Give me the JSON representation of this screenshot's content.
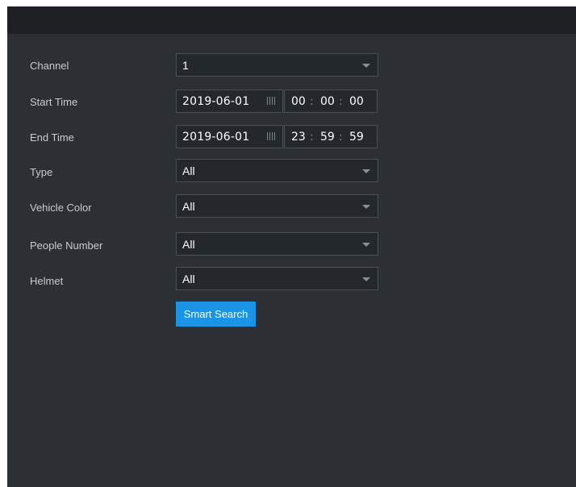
{
  "form": {
    "channel": {
      "label": "Channel",
      "value": "1"
    },
    "start_time": {
      "label": "Start Time",
      "date": "2019-06-01",
      "hh": "00",
      "mm": "00",
      "ss": "00"
    },
    "end_time": {
      "label": "End Time",
      "date": "2019-06-01",
      "hh": "23",
      "mm": "59",
      "ss": "59"
    },
    "type": {
      "label": "Type",
      "value": "All"
    },
    "vehicle_color": {
      "label": "Vehicle Color",
      "value": "All"
    },
    "people_number": {
      "label": "People Number",
      "value": "All"
    },
    "helmet": {
      "label": "Helmet",
      "value": "All"
    },
    "time_separator": ":"
  },
  "actions": {
    "smart_search_label": "Smart Search"
  },
  "colors": {
    "accent": "#1b94e8",
    "panel_bg": "#2c2f34",
    "titlebar_bg": "#1e2024"
  },
  "icons": {
    "dropdown": "chevron-down-icon",
    "date_picker": "calendar-icon"
  }
}
